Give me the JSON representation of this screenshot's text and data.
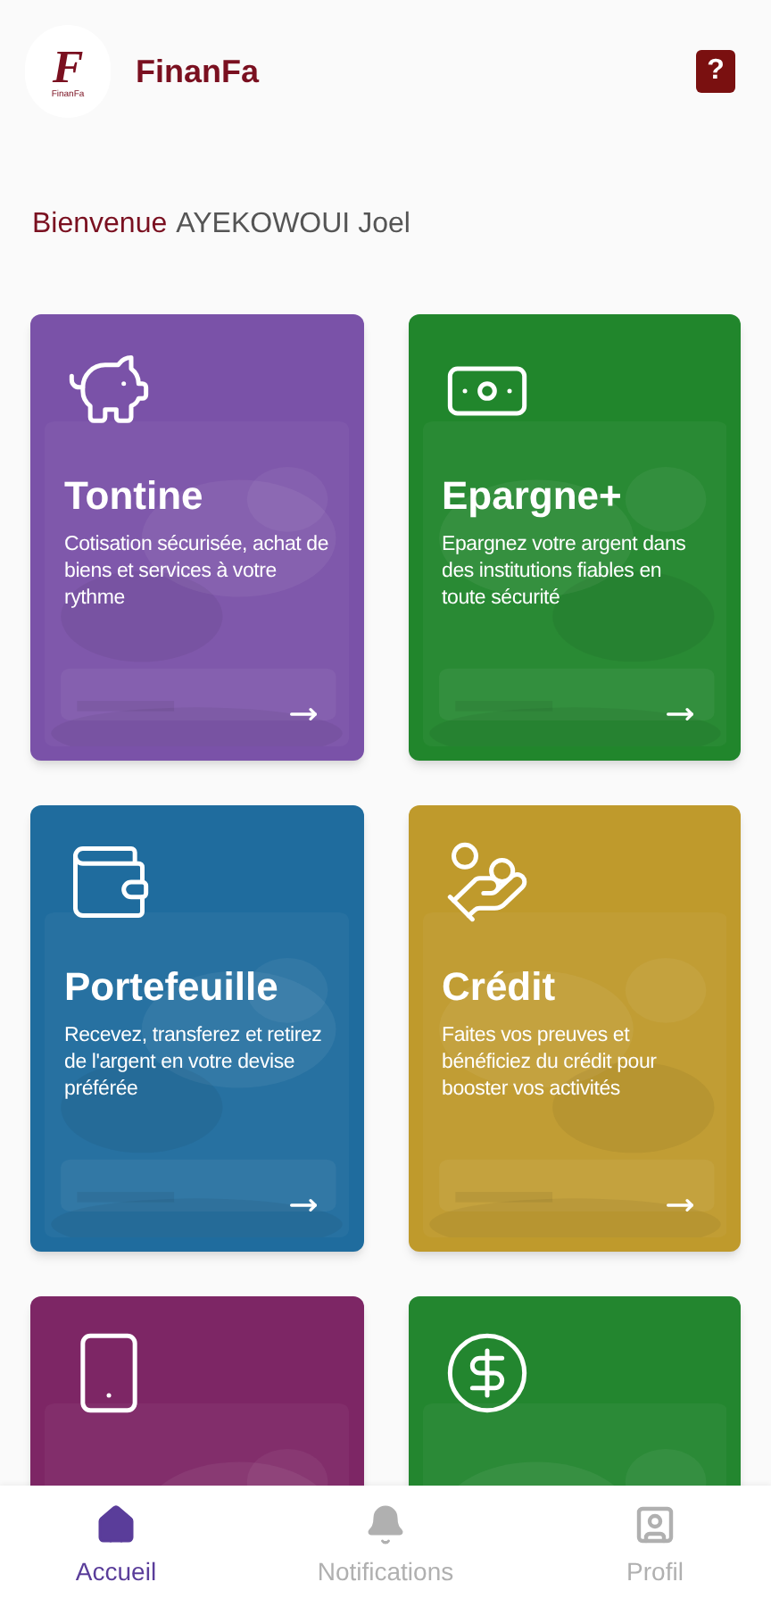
{
  "header": {
    "logo": {
      "letter": "F",
      "caption": "FinanFa"
    },
    "app_name": "FinanFa",
    "help_button": "?"
  },
  "welcome": {
    "greeting": "Bienvenue",
    "user_name": "AYEKOWOUI Joel"
  },
  "cards": [
    {
      "title": "Tontine",
      "description": "Cotisation sécurisée, achat de biens et services à votre rythme",
      "color": "#7a52a8"
    },
    {
      "title": "Epargne+",
      "description": "Epargnez votre argent dans des institutions fiables en toute sécurité",
      "color": "#21862c"
    },
    {
      "title": "Portefeuille",
      "description": "Recevez, transferez et retirez de l'argent en votre devise préférée",
      "color": "#1f6c9e"
    },
    {
      "title": "Crédit",
      "description": "Faites vos preuves et bénéficiez du crédit pour booster vos activités",
      "color": "#bf9a2c"
    },
    {
      "color": "#7d2665"
    },
    {
      "color": "#23862f"
    }
  ],
  "bottom_nav": [
    {
      "label": "Accueil",
      "selected": true
    },
    {
      "label": "Notifications",
      "selected": false
    },
    {
      "label": "Profil",
      "selected": false
    }
  ]
}
